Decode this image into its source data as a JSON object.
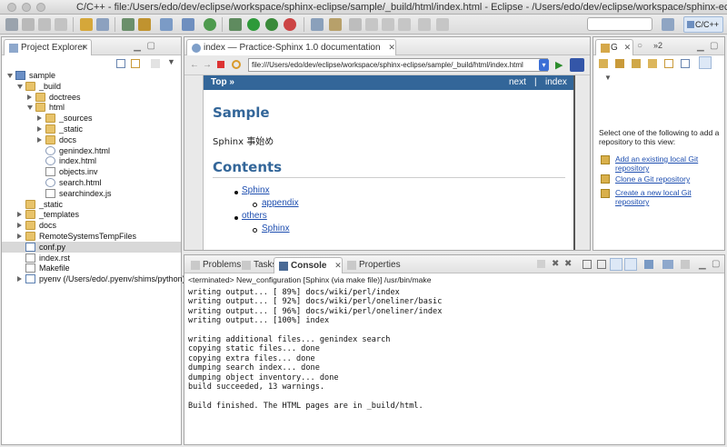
{
  "window": {
    "title": "C/C++ - file:/Users/edo/dev/eclipse/workspace/sphinx-eclipse/sample/_build/html/index.html - Eclipse - /Users/edo/dev/eclipse/workspace/sphinx-eclipse"
  },
  "toolbar": {
    "perspective_label": "C/C++"
  },
  "project_explorer": {
    "tab_label": "Project Explorer",
    "tree": [
      {
        "label": "sample",
        "depth": 0,
        "kind": "project",
        "expanded": true
      },
      {
        "label": "_build",
        "depth": 1,
        "kind": "folder",
        "expanded": true
      },
      {
        "label": "doctrees",
        "depth": 2,
        "kind": "folder",
        "expanded": false
      },
      {
        "label": "html",
        "depth": 2,
        "kind": "folder",
        "expanded": true
      },
      {
        "label": "_sources",
        "depth": 3,
        "kind": "folder",
        "expanded": false
      },
      {
        "label": "_static",
        "depth": 3,
        "kind": "folder",
        "expanded": false
      },
      {
        "label": "docs",
        "depth": 3,
        "kind": "folder",
        "expanded": false
      },
      {
        "label": "genindex.html",
        "depth": 3,
        "kind": "html"
      },
      {
        "label": "index.html",
        "depth": 3,
        "kind": "html"
      },
      {
        "label": "objects.inv",
        "depth": 3,
        "kind": "txt"
      },
      {
        "label": "search.html",
        "depth": 3,
        "kind": "html"
      },
      {
        "label": "searchindex.js",
        "depth": 3,
        "kind": "js"
      },
      {
        "label": "_static",
        "depth": 1,
        "kind": "folder"
      },
      {
        "label": "_templates",
        "depth": 1,
        "kind": "folder",
        "expanded": false
      },
      {
        "label": "docs",
        "depth": 1,
        "kind": "folder",
        "expanded": false
      },
      {
        "label": "RemoteSystemsTempFiles",
        "depth": 1,
        "kind": "folder",
        "expanded": false
      },
      {
        "label": "conf.py",
        "depth": 1,
        "kind": "py",
        "selected": true
      },
      {
        "label": "index.rst",
        "depth": 1,
        "kind": "txt"
      },
      {
        "label": "Makefile",
        "depth": 1,
        "kind": "txt"
      },
      {
        "label": "pyenv  (/Users/edo/.pyenv/shims/python)",
        "depth": 1,
        "kind": "py",
        "expanded": false
      }
    ]
  },
  "browser": {
    "tab_label": "index — Practice-Sphinx 1.0 documentation",
    "url": "file:///Users/edo/dev/eclipse/workspace/sphinx-eclipse/sample/_build/html/index.html",
    "nav_top": "Top »",
    "nav_next": "next",
    "nav_sep": "|",
    "nav_index": "index",
    "page_title": "Sample",
    "intro": "Sphinx 事始め",
    "contents_heading": "Contents",
    "toc": [
      {
        "label": "Sphinx",
        "children": [
          "appendix"
        ]
      },
      {
        "label": "others",
        "children": [
          "Sphinx"
        ]
      }
    ]
  },
  "git_view": {
    "tab_label": "G",
    "tab2_label": "»2",
    "message": "Select one of the following to add a repository to this view:",
    "links": [
      "Add an existing local Git repository",
      "Clone a Git repository",
      "Create a new local Git repository"
    ]
  },
  "bottom_panel": {
    "tabs": [
      "Problems",
      "Tasks",
      "Console",
      "Properties"
    ],
    "active_tab": "Console",
    "status": "<terminated> New_configuration [Sphinx (via make file)] /usr/bin/make",
    "console_lines": [
      "writing output... [ 89%] docs/wiki/perl/index",
      "writing output... [ 92%] docs/wiki/perl/oneliner/basic",
      "writing output... [ 96%] docs/wiki/perl/oneliner/index",
      "writing output... [100%] index",
      "",
      "writing additional files... genindex search",
      "copying static files... done",
      "copying extra files... done",
      "dumping search index... done",
      "dumping object inventory... done",
      "build succeeded, 13 warnings.",
      "",
      "Build finished. The HTML pages are in _build/html."
    ]
  },
  "colors": {
    "sphinx_header": "#336699",
    "link": "#1f4fb0",
    "folder": "#e8c36a"
  }
}
